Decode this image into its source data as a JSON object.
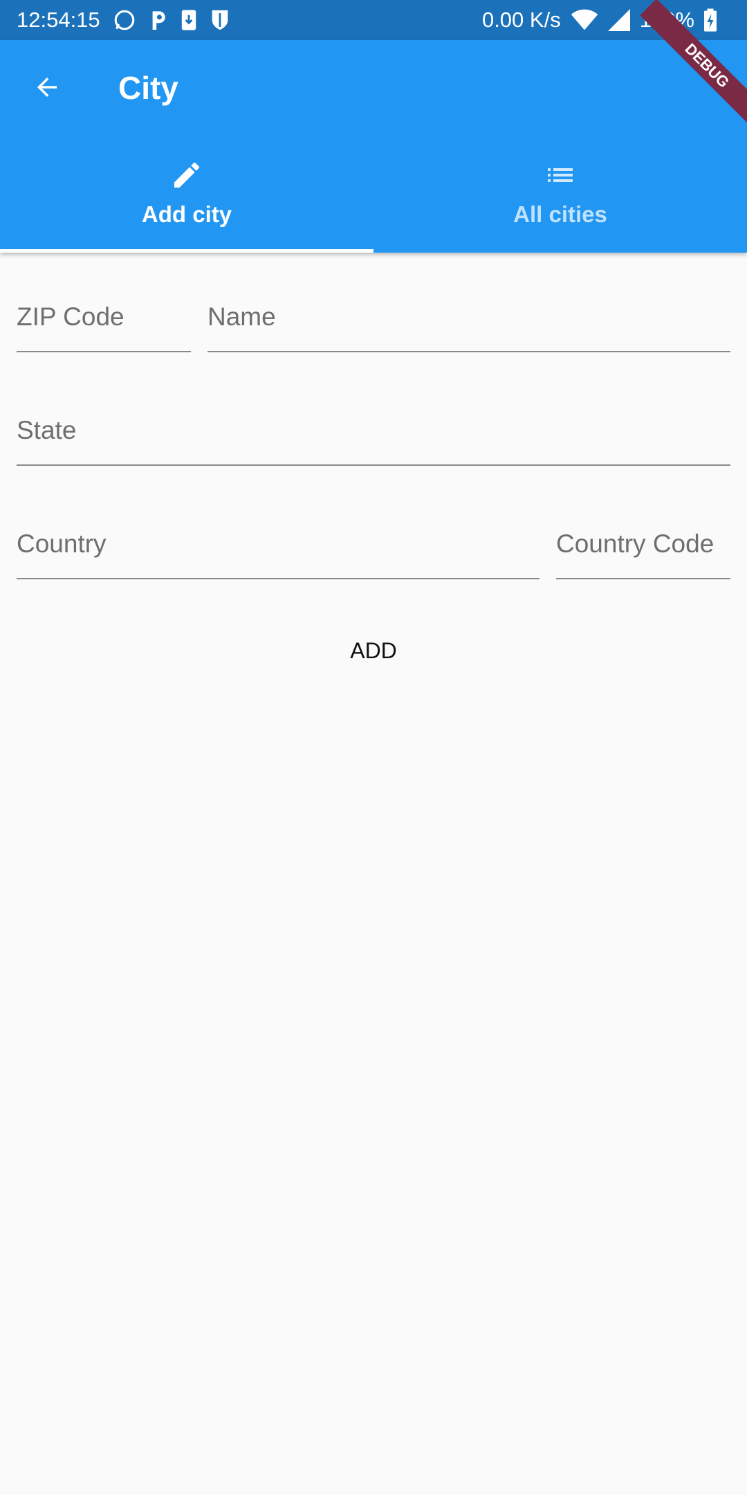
{
  "status_bar": {
    "time": "12:54:15",
    "net_speed": "0.00 K/s",
    "battery": "100%",
    "icons": [
      "whatsapp-icon",
      "p-icon",
      "download-icon",
      "shield-icon",
      "wifi-icon",
      "signal-icon",
      "battery-charging-icon"
    ]
  },
  "app_bar": {
    "title": "City",
    "back_icon": "arrow-back-icon"
  },
  "tabs": [
    {
      "label": "Add city",
      "icon": "pencil-icon",
      "selected": true
    },
    {
      "label": "All cities",
      "icon": "list-icon",
      "selected": false
    }
  ],
  "form": {
    "zip": "ZIP Code",
    "name": "Name",
    "state": "State",
    "country": "Country",
    "country_code": "Country Code",
    "add_label": "ADD"
  },
  "debug_banner": "DEBUG",
  "colors": {
    "primary": "#2196f3",
    "status_bar": "#1b72bb",
    "background": "#fafafa"
  }
}
